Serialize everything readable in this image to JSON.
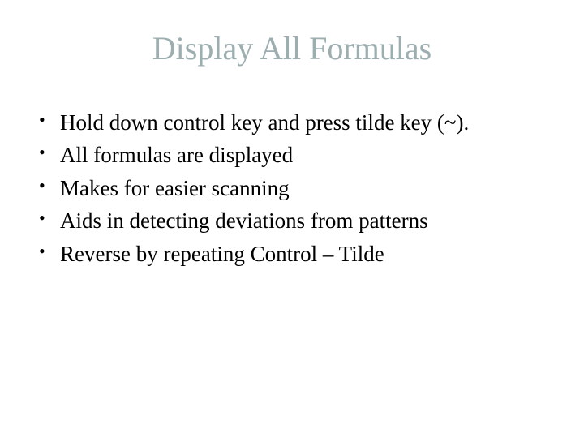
{
  "title": "Display All Formulas",
  "bullets": [
    "Hold down control key and press tilde key (~).",
    "All formulas are displayed",
    "Makes for easier scanning",
    "Aids in detecting deviations from patterns",
    "Reverse by repeating Control – Tilde"
  ]
}
